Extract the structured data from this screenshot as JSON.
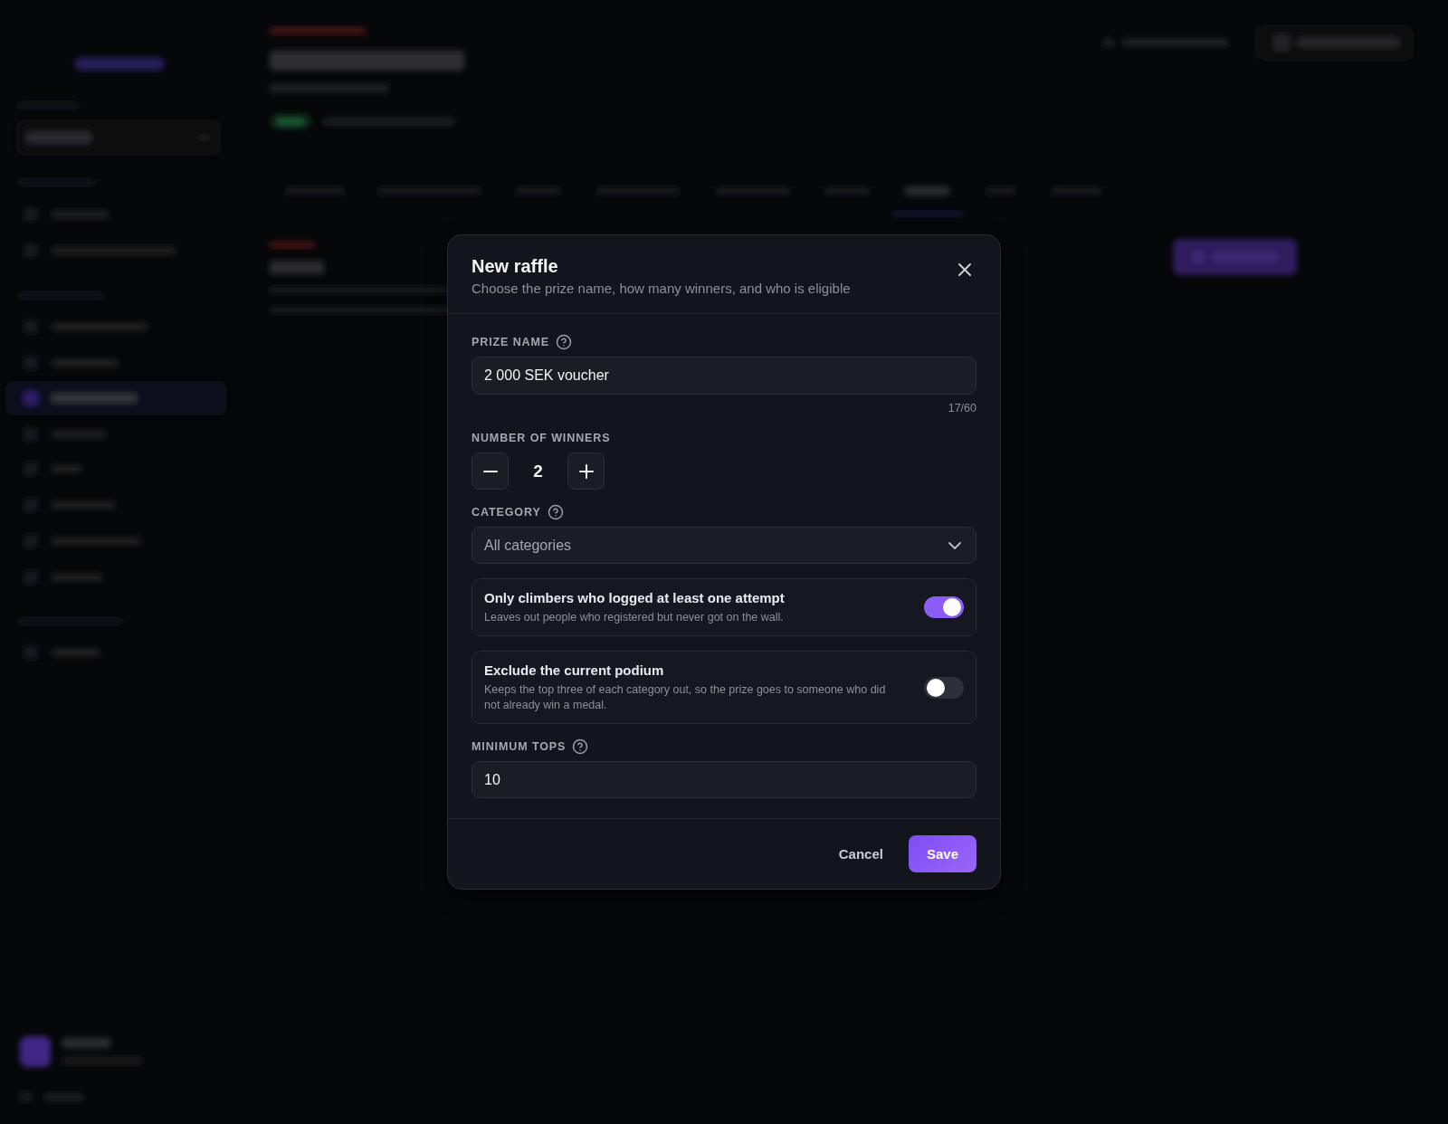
{
  "dialog": {
    "title": "New raffle",
    "subtitle": "Choose the prize name, how many winners, and who is eligible"
  },
  "fields": [
    {
      "kind": "text",
      "label": "PRIZE NAME",
      "help": true,
      "value": "2 000 SEK voucher",
      "counter": "17/60"
    },
    {
      "kind": "stepper",
      "label": "NUMBER OF WINNERS",
      "help": false,
      "value": "2"
    },
    {
      "kind": "select",
      "label": "CATEGORY",
      "help": true,
      "value": "All categories"
    },
    {
      "kind": "toggle",
      "title": "Only climbers who logged at least one attempt",
      "description": "Leaves out people who registered but never got on the wall.",
      "on": true
    },
    {
      "kind": "toggle",
      "title": "Exclude the current podium",
      "description": "Keeps the top three of each category out, so the prize goes to someone who did not already win a medal.",
      "on": false
    },
    {
      "kind": "text",
      "label": "MINIMUM TOPS",
      "help": true,
      "value": "10"
    }
  ],
  "buttons": [
    {
      "kind": "secondary",
      "label": "Cancel"
    },
    {
      "kind": "primary",
      "label": "Save"
    }
  ]
}
